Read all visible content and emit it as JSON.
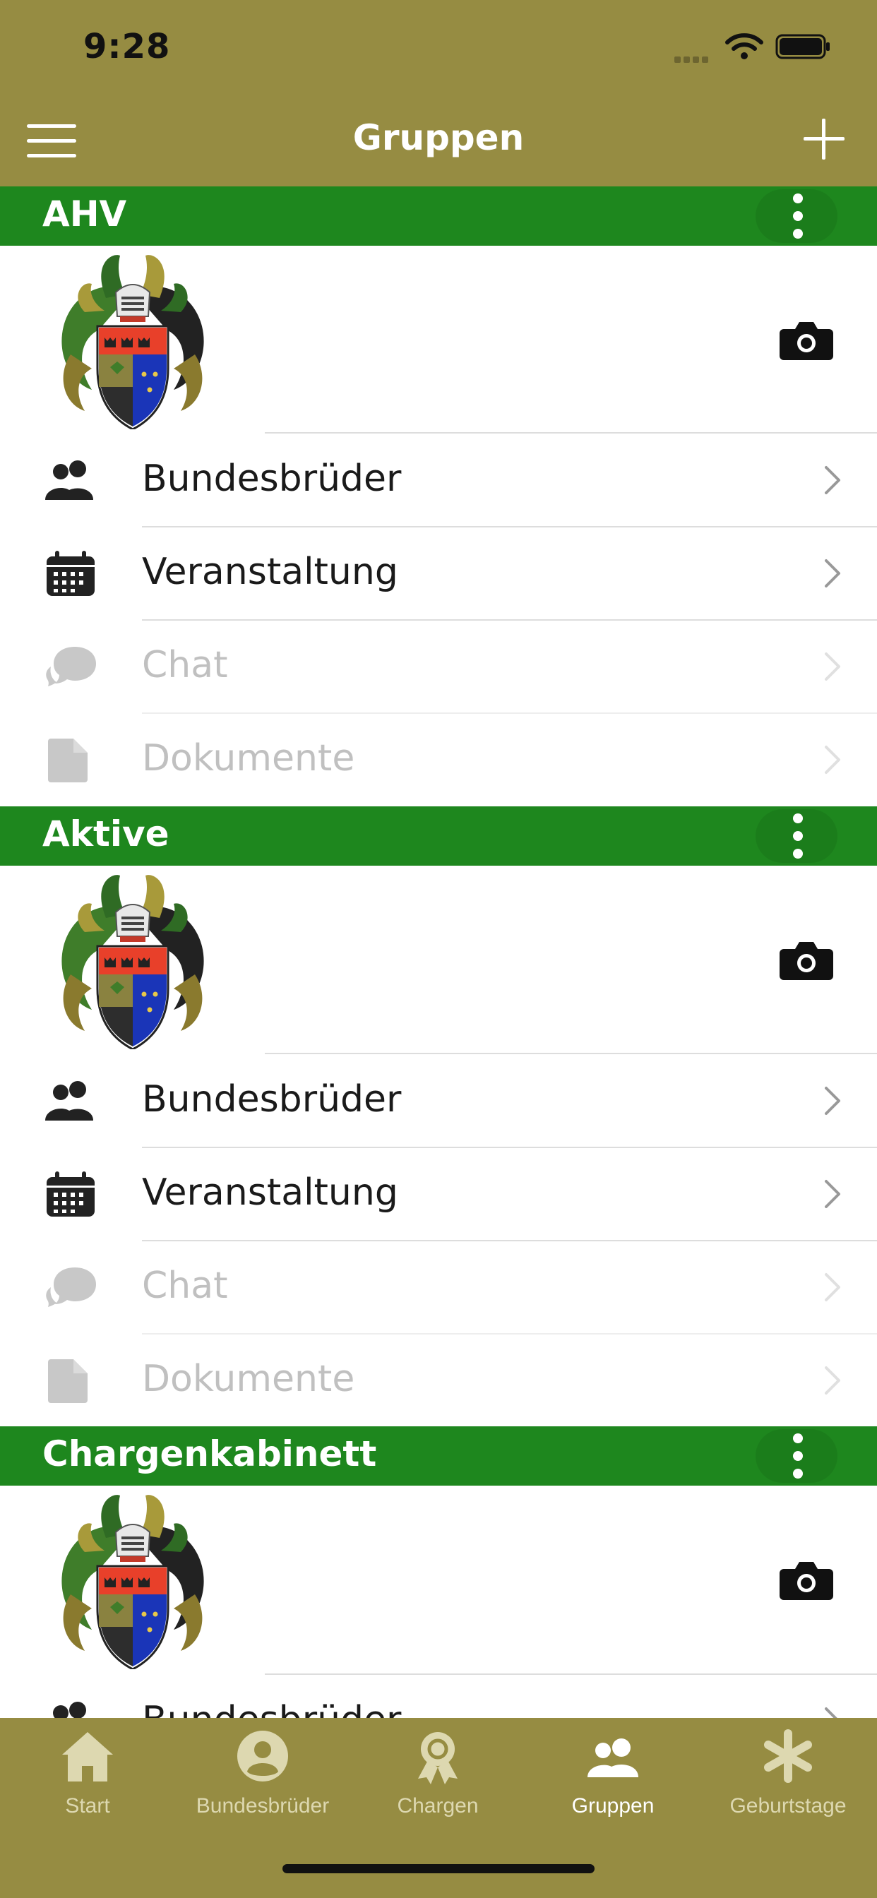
{
  "status_bar": {
    "time": "9:28"
  },
  "nav": {
    "title": "Gruppen"
  },
  "groups": [
    {
      "title": "AHV",
      "rows": [
        {
          "label": "Bundesbrüder",
          "icon": "users-icon",
          "enabled": true
        },
        {
          "label": "Veranstaltung",
          "icon": "calendar-icon",
          "enabled": true
        },
        {
          "label": "Chat",
          "icon": "chat-icon",
          "enabled": false
        },
        {
          "label": "Dokumente",
          "icon": "document-icon",
          "enabled": false
        }
      ]
    },
    {
      "title": "Aktive",
      "rows": [
        {
          "label": "Bundesbrüder",
          "icon": "users-icon",
          "enabled": true
        },
        {
          "label": "Veranstaltung",
          "icon": "calendar-icon",
          "enabled": true
        },
        {
          "label": "Chat",
          "icon": "chat-icon",
          "enabled": false
        },
        {
          "label": "Dokumente",
          "icon": "document-icon",
          "enabled": false
        }
      ]
    },
    {
      "title": "Chargenkabinett",
      "rows": [
        {
          "label": "Bundesbrüder",
          "icon": "users-icon",
          "enabled": true
        }
      ]
    }
  ],
  "tabs": [
    {
      "label": "Start",
      "icon": "home-icon",
      "active": false
    },
    {
      "label": "Bundesbrüder",
      "icon": "person-icon",
      "active": false
    },
    {
      "label": "Chargen",
      "icon": "award-icon",
      "active": false
    },
    {
      "label": "Gruppen",
      "icon": "group-icon",
      "active": true
    },
    {
      "label": "Geburtstage",
      "icon": "asterisk-icon",
      "active": false
    }
  ],
  "colors": {
    "bar_olive": "#968c42",
    "group_header_green": "#1e871e",
    "disabled_text": "#c0c0c0",
    "inactive_tab_label": "#ddd8b0"
  }
}
